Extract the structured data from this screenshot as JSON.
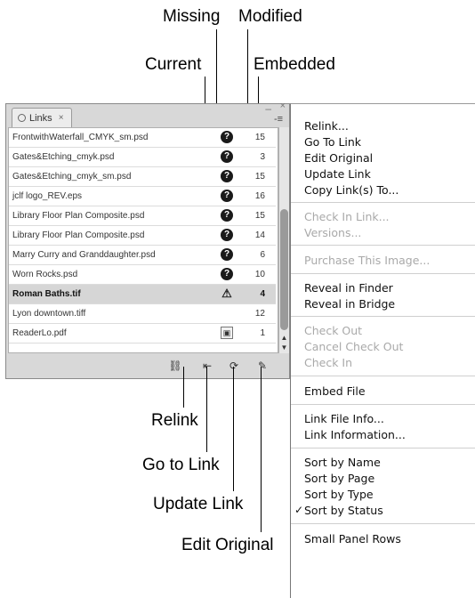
{
  "callouts": {
    "missing": "Missing",
    "modified": "Modified",
    "current": "Current",
    "embedded": "Embedded",
    "relink": "Relink",
    "go_to_link": "Go to Link",
    "update_link": "Update Link",
    "edit_original": "Edit Original"
  },
  "panel": {
    "tab_label": "Links",
    "tab_close": "×",
    "minimize": "–",
    "close": "×",
    "menu_button": "-≡",
    "rows": [
      {
        "name": "FrontwithWaterfall_CMYK_sm.psd",
        "status_glyph": "?",
        "page": "15"
      },
      {
        "name": "Gates&Etching_cmyk.psd",
        "status_glyph": "?",
        "page": "3"
      },
      {
        "name": "Gates&Etching_cmyk_sm.psd",
        "status_glyph": "?",
        "page": "15"
      },
      {
        "name": "jclf logo_REV.eps",
        "status_glyph": "?",
        "page": "16"
      },
      {
        "name": "Library Floor Plan Composite.psd",
        "status_glyph": "?",
        "page": "15"
      },
      {
        "name": "Library Floor Plan Composite.psd",
        "status_glyph": "?",
        "page": "14"
      },
      {
        "name": "Marry Curry and Granddaughter.psd",
        "status_glyph": "?",
        "page": "6"
      },
      {
        "name": "Worn Rocks.psd",
        "status_glyph": "?",
        "page": "10"
      },
      {
        "name": "Roman Baths.tif",
        "status_glyph": "⚠",
        "page": "4"
      },
      {
        "name": "Lyon downtown.tiff",
        "status_glyph": "",
        "page": "12"
      },
      {
        "name": "ReaderLo.pdf",
        "status_glyph": "▣",
        "page": "1"
      }
    ],
    "toolbar_icons": [
      "relink-icon",
      "go-to-link-icon",
      "update-link-icon",
      "edit-original-icon"
    ]
  },
  "menu": {
    "items": [
      {
        "label": "Relink...",
        "enabled": true
      },
      {
        "label": "Go To Link",
        "enabled": true
      },
      {
        "label": "Edit Original",
        "enabled": true
      },
      {
        "label": "Update Link",
        "enabled": true
      },
      {
        "label": "Copy Link(s) To...",
        "enabled": true
      },
      {
        "label": "Check In Link...",
        "enabled": false
      },
      {
        "label": "Versions...",
        "enabled": false
      },
      {
        "label": "Purchase This Image...",
        "enabled": false
      },
      {
        "label": "Reveal in Finder",
        "enabled": true
      },
      {
        "label": "Reveal in Bridge",
        "enabled": true
      },
      {
        "label": "Check Out",
        "enabled": false
      },
      {
        "label": "Cancel Check Out",
        "enabled": false
      },
      {
        "label": "Check In",
        "enabled": false
      },
      {
        "label": "Embed File",
        "enabled": true
      },
      {
        "label": "Link File Info...",
        "enabled": true
      },
      {
        "label": "Link Information...",
        "enabled": true
      },
      {
        "label": "Sort by Name",
        "enabled": true
      },
      {
        "label": "Sort by Page",
        "enabled": true
      },
      {
        "label": "Sort by Type",
        "enabled": true
      },
      {
        "label": "Sort by Status",
        "enabled": true,
        "checked": true,
        "check_glyph": "✓"
      },
      {
        "label": "Small Panel Rows",
        "enabled": true
      }
    ]
  }
}
